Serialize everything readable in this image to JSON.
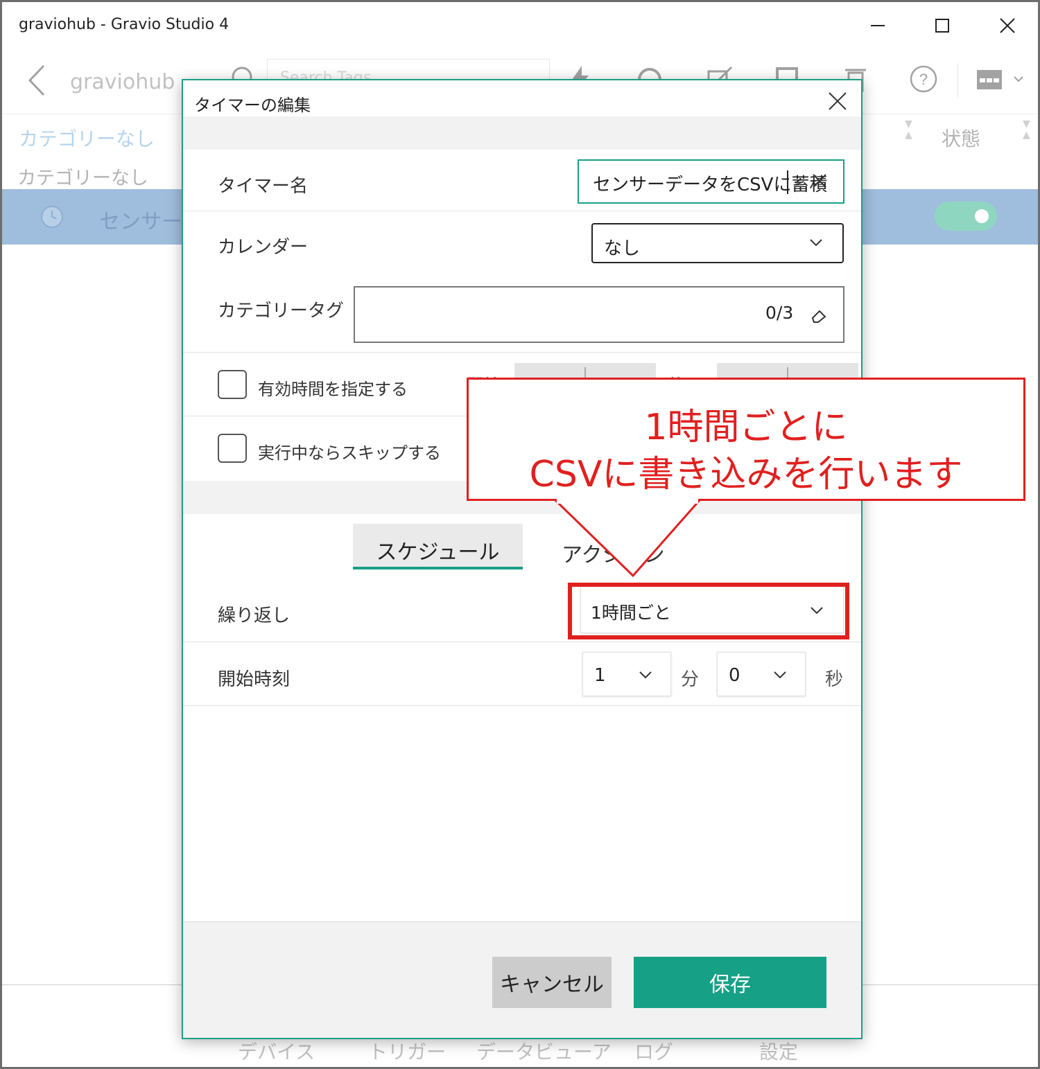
{
  "window": {
    "title": "graviohub - Gravio Studio 4"
  },
  "toolbar": {
    "breadcrumb": "graviohub",
    "search_placeholder": "Search Tags"
  },
  "list": {
    "header_category": "カテゴリーなし",
    "header_status": "状態",
    "group_label": "カテゴリーなし",
    "row_name": "センサーデータをCSVに蓄積",
    "row_enabled": true
  },
  "bottom_nav": [
    "デバイス",
    "トリガー",
    "データビューア",
    "ログ",
    "設定"
  ],
  "dialog": {
    "title": "タイマーの編集",
    "timer_name_label": "タイマー名",
    "timer_name_value": "センサーデータをCSVに蓄積",
    "calendar_label": "カレンダー",
    "calendar_value": "なし",
    "category_tag_label": "カテゴリータグ",
    "category_tag_count": "0/3",
    "valid_time_label": "有効時間を指定する",
    "valid_time_checked": false,
    "start_label": "開始",
    "end_label": "終了",
    "skip_running_label": "実行中ならスキップする",
    "skip_running_checked": false,
    "tab_schedule": "スケジュール",
    "tab_action": "アクション",
    "repeat_label": "繰り返し",
    "repeat_value": "1時間ごと",
    "start_time_label": "開始時刻",
    "start_minute": "1",
    "minute_unit": "分",
    "start_second": "0",
    "second_unit": "秒",
    "cancel_button": "キャンセル",
    "save_button": "保存"
  },
  "annotation": {
    "line1": "1時間ごとに",
    "line2": "CSVに書き込みを行います"
  },
  "colors": {
    "accent": "#16a085",
    "selection_row": "#9fbedd",
    "annotation_red": "#e0201f"
  }
}
